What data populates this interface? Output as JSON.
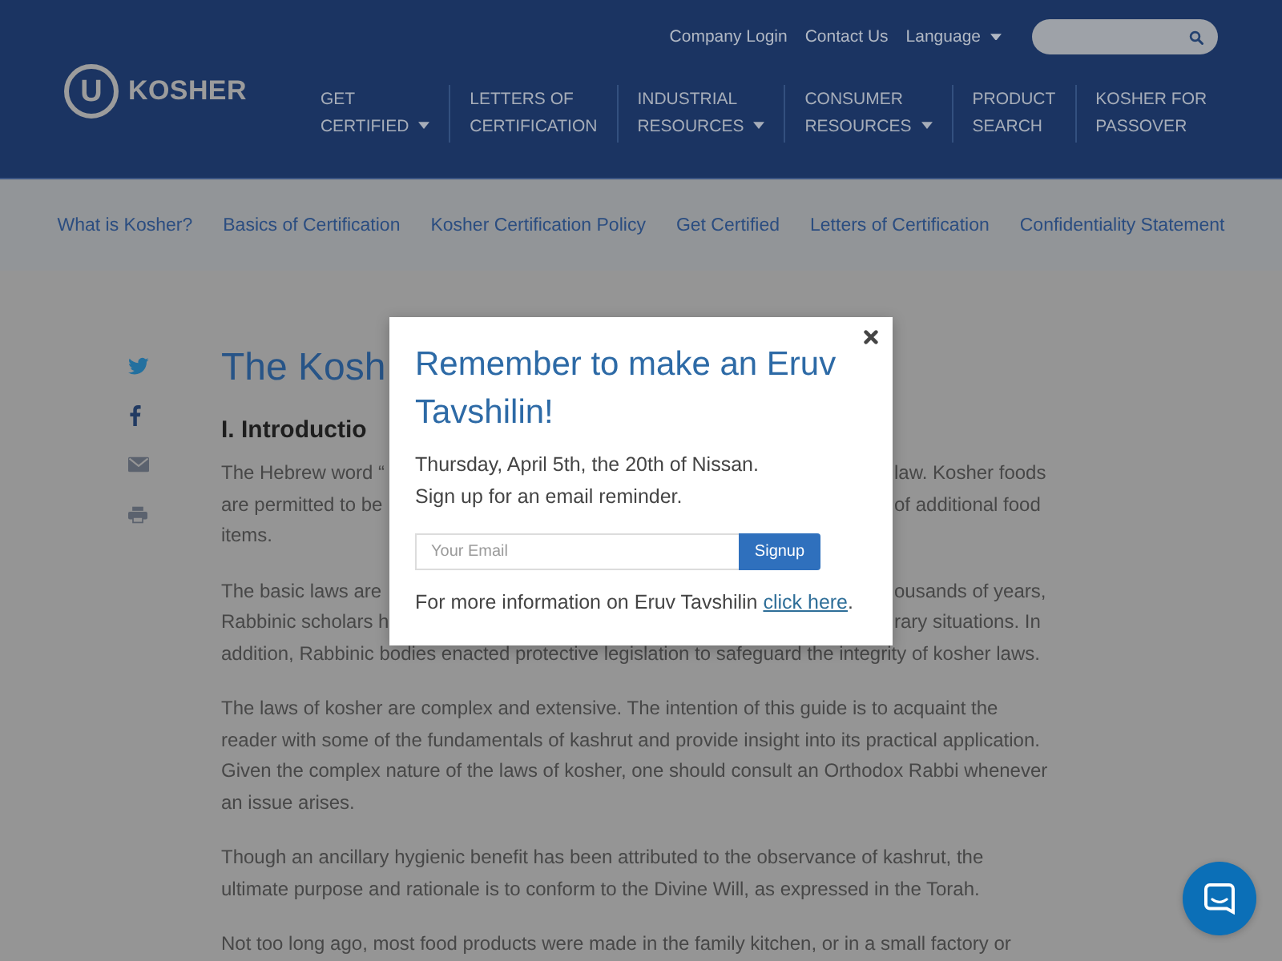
{
  "header": {
    "logo": {
      "mark": "U",
      "text": "KOSHER"
    },
    "top_links": [
      {
        "label": "Company Login",
        "kind": "link"
      },
      {
        "label": "Contact Us",
        "kind": "link"
      },
      {
        "label": "Language",
        "kind": "dropdown"
      }
    ],
    "nav": [
      {
        "lines": [
          "GET",
          "CERTIFIED"
        ],
        "kind": "dropdown"
      },
      {
        "lines": [
          "LETTERS OF",
          "CERTIFICATION"
        ],
        "kind": "link"
      },
      {
        "lines": [
          "INDUSTRIAL",
          "RESOURCES"
        ],
        "kind": "dropdown"
      },
      {
        "lines": [
          "CONSUMER",
          "RESOURCES"
        ],
        "kind": "dropdown"
      },
      {
        "lines": [
          "PRODUCT",
          "SEARCH"
        ],
        "kind": "link"
      },
      {
        "lines": [
          "KOSHER FOR",
          "PASSOVER"
        ],
        "kind": "link"
      }
    ]
  },
  "subnav": [
    "What is Kosher?",
    "Basics of Certification",
    "Kosher Certification Policy",
    "Get Certified",
    "Letters of Certification",
    "Confidentiality Statement"
  ],
  "article": {
    "title": "The Kosh",
    "heading": "I. Introductio",
    "paragraphs": [
      {
        "kind": "covered",
        "lines": [
          [
            "The Hebrew word “",
            "law. Kosher foods"
          ],
          [
            "are permitted to be",
            "of additional food"
          ],
          [
            "items."
          ]
        ]
      },
      {
        "kind": "covered",
        "lines": [
          [
            "The basic laws are",
            "ousands of years,"
          ],
          [
            "Rabbinic scholars h",
            "rary situations. In"
          ],
          [
            "addition, Rabbinic bodies enacted protective legislation to safeguard the integrity of kosher laws."
          ]
        ]
      },
      {
        "kind": "plain",
        "lines": [
          "The laws of kosher are complex and extensive. The intention of this guide is to acquaint the",
          "reader with some of the fundamentals of kashrut and provide insight into its practical application.",
          "Given the complex nature of the laws of kosher, one should consult an Orthodox Rabbi whenever",
          "an issue arises."
        ]
      },
      {
        "kind": "plain",
        "lines": [
          "Though an ancillary hygienic benefit has been attributed to the observance of kashrut, the",
          "ultimate purpose and rationale is to conform to the Divine Will, as expressed in the Torah."
        ]
      },
      {
        "kind": "plain",
        "lines": [
          "Not too long ago, most food products were made in the family kitchen, or in a small factory or"
        ]
      }
    ]
  },
  "modal": {
    "title": "Remember to make an Eruv Tavshilin!",
    "lines": [
      "Thursday, April 5th, the 20th of Nissan.",
      "Sign up for an email reminder."
    ],
    "email": {
      "placeholder": "Your Email"
    },
    "button": "Signup",
    "footer": {
      "text": "For more information on Eruv Tavshilin",
      "link": "click here",
      "after": "."
    }
  }
}
